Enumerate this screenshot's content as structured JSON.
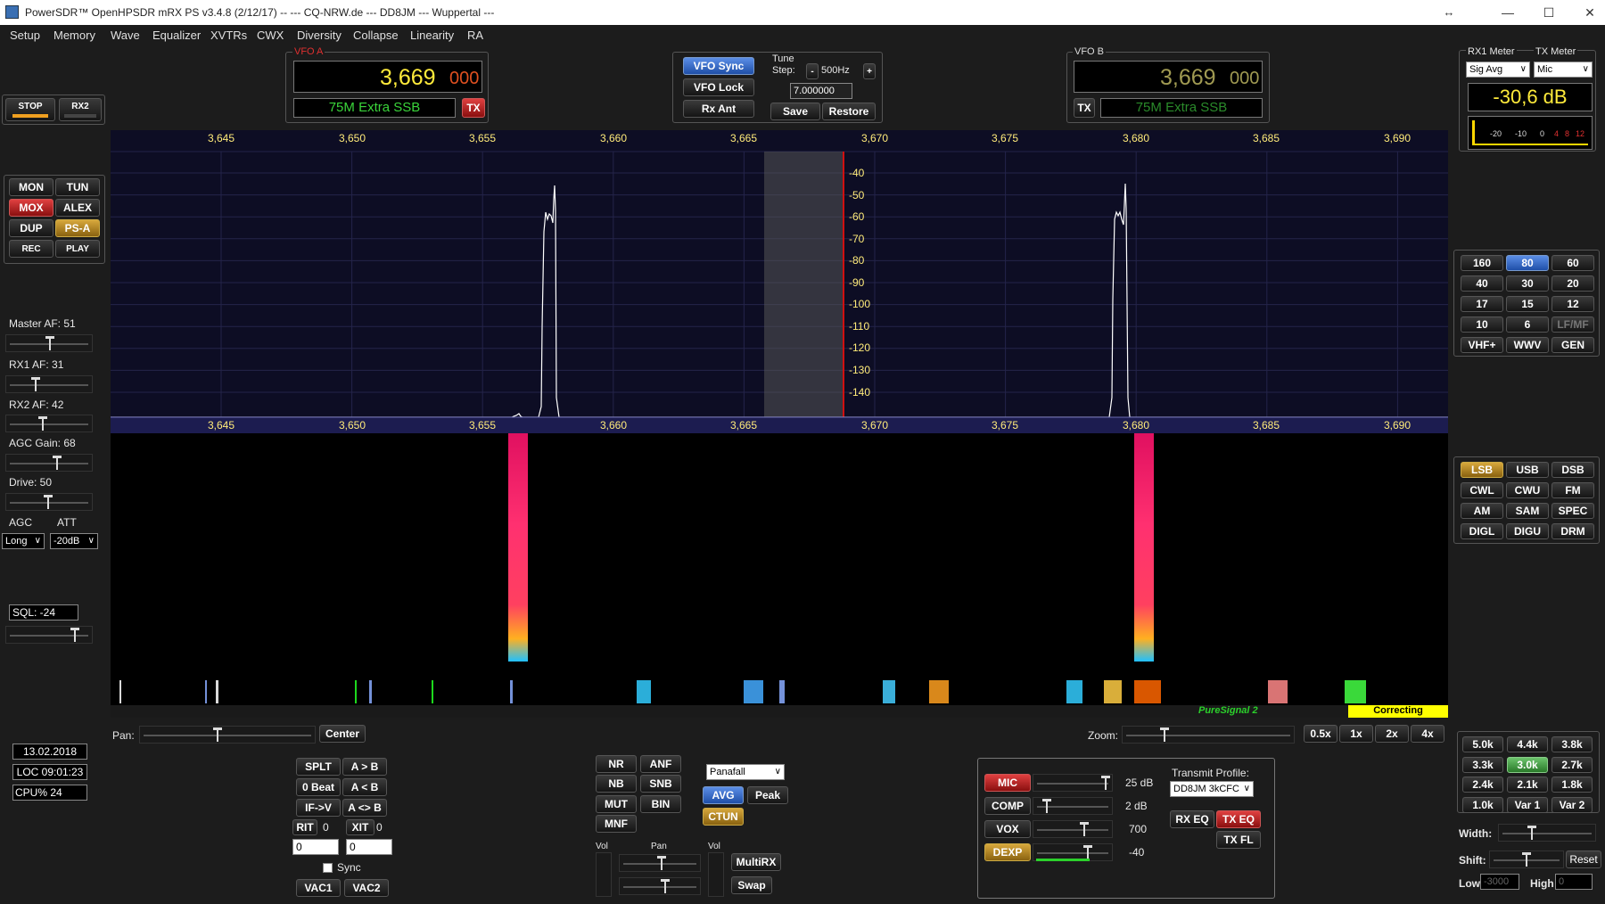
{
  "window": {
    "title": "PowerSDR™ OpenHPSDR mRX PS v3.4.8 (2/12/17)  --   ---  CQ-NRW.de  ---  DD8JM  ---  Wuppertal  ---"
  },
  "menu": [
    "Setup",
    "Memory",
    "Wave",
    "Equalizer",
    "XVTRs",
    "CWX",
    "Diversity",
    "Collapse",
    "Linearity",
    "RA"
  ],
  "power": {
    "stop": "STOP",
    "rx2": "RX2"
  },
  "vfo_a": {
    "label": "VFO A",
    "freq_main": "3,669",
    "freq_sub": "000",
    "band": "75M Extra SSB",
    "tx": "TX"
  },
  "vfo_b": {
    "label": "VFO B",
    "freq_main": "3,669",
    "freq_sub": "000",
    "band": "75M Extra SSB",
    "tx": "TX"
  },
  "vfo_center": {
    "sync": "VFO Sync",
    "lock": "VFO Lock",
    "rxant": "Rx Ant",
    "tune_step_label": "Tune\nStep:",
    "tune_step": "500Hz",
    "minus": "-",
    "plus": "+",
    "freq_field": "7.000000",
    "save": "Save",
    "restore": "Restore"
  },
  "meters": {
    "rx1_label": "RX1 Meter",
    "tx_label": "TX Meter",
    "rx1_mode": "Sig Avg",
    "tx_mode": "Mic",
    "reading": "-30,6 dB",
    "scale": [
      "-20",
      "-10",
      "0",
      "4",
      "8",
      "12"
    ]
  },
  "left_buttons": {
    "mon": "MON",
    "tun": "TUN",
    "mox": "MOX",
    "alex": "ALEX",
    "dup": "DUP",
    "psa": "PS-A",
    "rec": "REC",
    "play": "PLAY"
  },
  "levels": {
    "master_af": "Master AF:  51",
    "rx1_af": "RX1 AF:  31",
    "rx2_af": "RX2 AF:  42",
    "agc_gain": "AGC Gain:  68",
    "drive": "Drive:  50",
    "agc": "AGC",
    "att": "ATT",
    "agc_mode": "Long",
    "att_mode": "-20dB",
    "sql": "SQL:  -24"
  },
  "status": {
    "date": "13.02.2018",
    "loc": "LOC 09:01:23",
    "cpu": "CPU%  24"
  },
  "spectrum": {
    "freq_ticks": [
      "3,645",
      "3,650",
      "3,655",
      "3,660",
      "3,665",
      "3,670",
      "3,675",
      "3,680",
      "3,685",
      "3,690"
    ],
    "db_ticks": [
      "-40",
      "-50",
      "-60",
      "-70",
      "-80",
      "-90",
      "-100",
      "-110",
      "-120",
      "-130",
      "-140"
    ],
    "pure_signal": "PureSignal 2",
    "correcting": "Correcting",
    "colors": {
      "background": "#0d0d24",
      "trace": "#ffffff",
      "cursor": "#d01010",
      "filter": "#555555"
    }
  },
  "pan": {
    "label": "Pan:",
    "center": "Center",
    "zoom_label": "Zoom:",
    "zoom": [
      "0.5x",
      "1x",
      "2x",
      "4x"
    ]
  },
  "bands": [
    "160",
    "80",
    "60",
    "40",
    "30",
    "20",
    "17",
    "15",
    "12",
    "10",
    "6",
    "LF/MF",
    "VHF+",
    "WWV",
    "GEN"
  ],
  "modes": [
    "LSB",
    "USB",
    "DSB",
    "CWL",
    "CWU",
    "FM",
    "AM",
    "SAM",
    "SPEC",
    "DIGL",
    "DIGU",
    "DRM"
  ],
  "filters": [
    "5.0k",
    "4.4k",
    "3.8k",
    "3.3k",
    "3.0k",
    "2.7k",
    "2.4k",
    "2.1k",
    "1.8k",
    "1.0k",
    "Var 1",
    "Var 2"
  ],
  "filter_ctrl": {
    "width": "Width:",
    "shift": "Shift:",
    "reset": "Reset",
    "low": "Low",
    "high": "High",
    "low_val": "-3000",
    "high_val": "0"
  },
  "split": {
    "splt": "SPLT",
    "atob": "A > B",
    "zerobeat": "0 Beat",
    "btoa": "A < B",
    "ifv": "IF->V",
    "swap": "A <> B",
    "rit": "RIT",
    "rit_val": "0",
    "xit": "XIT",
    "xit_val": "0",
    "rit_field": "0",
    "xit_field": "0",
    "sync": "Sync",
    "vac1": "VAC1",
    "vac2": "VAC2"
  },
  "dsp": {
    "nr": "NR",
    "anf": "ANF",
    "nb": "NB",
    "snb": "SNB",
    "mut": "MUT",
    "bin": "BIN",
    "mnf": "MNF",
    "display": "Panafall",
    "avg": "AVG",
    "peak": "Peak",
    "ctun": "CTUN",
    "vol": "Vol",
    "pan": "Pan",
    "vol2": "Vol",
    "multirx": "MultiRX",
    "swap": "Swap"
  },
  "tx": {
    "mic": "MIC",
    "mic_val": "25 dB",
    "comp": "COMP",
    "comp_val": "2 dB",
    "vox": "VOX",
    "vox_val": "700",
    "dexp": "DEXP",
    "dexp_val": "-40",
    "profile_label": "Transmit Profile:",
    "profile": "DD8JM 3kCFC",
    "rxeq": "RX EQ",
    "txeq": "TX EQ",
    "txfl": "TX FL"
  }
}
